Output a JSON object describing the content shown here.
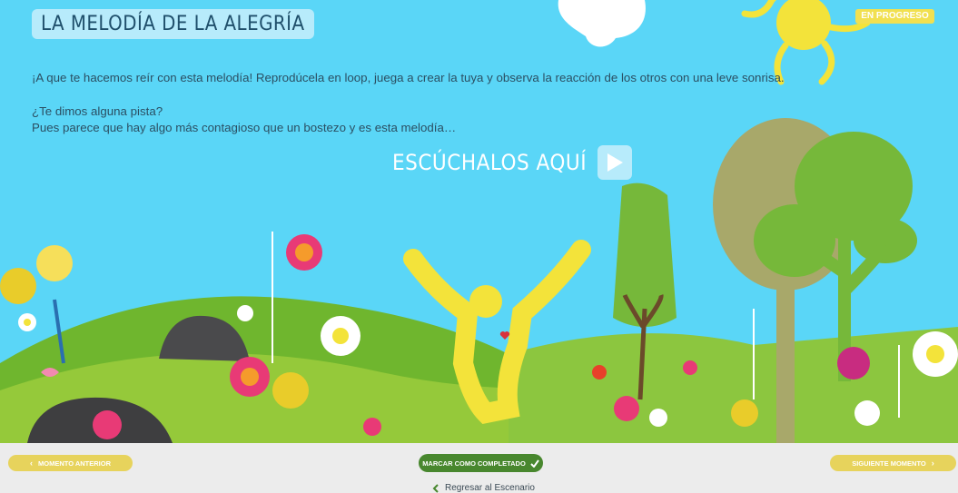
{
  "header": {
    "title": "LA MELODÍA DE LA ALEGRÍA",
    "status": "EN PROGRESO"
  },
  "content": {
    "intro": "¡A que te hacemos reír con esta melodía! Reprodúcela en loop, juega a crear la tuya y observa la reacción de los otros con una leve sonrisa.",
    "hint_question": "¿Te dimos alguna pista?",
    "hint_text": "Pues parece que hay algo más contagioso que un bostezo y es esta melodía…",
    "listen_label": "ESCÚCHALOS AQUÍ"
  },
  "footer": {
    "prev_label": "MOMENTO ANTERIOR",
    "complete_label": "MARCAR COMO COMPLETADO",
    "next_label": "SIGUIENTE MOMENTO",
    "back_link": "Regresar al Escenario"
  },
  "icons": {
    "play": "play-icon",
    "prev": "chevron-left-icon",
    "next": "chevron-right-icon",
    "check": "check-icon",
    "back": "chevron-left-icon"
  },
  "colors": {
    "sky": "#5ad6f7",
    "yellow_button": "#e7d35c",
    "green_button": "#48872e",
    "badge": "#f1e050"
  }
}
